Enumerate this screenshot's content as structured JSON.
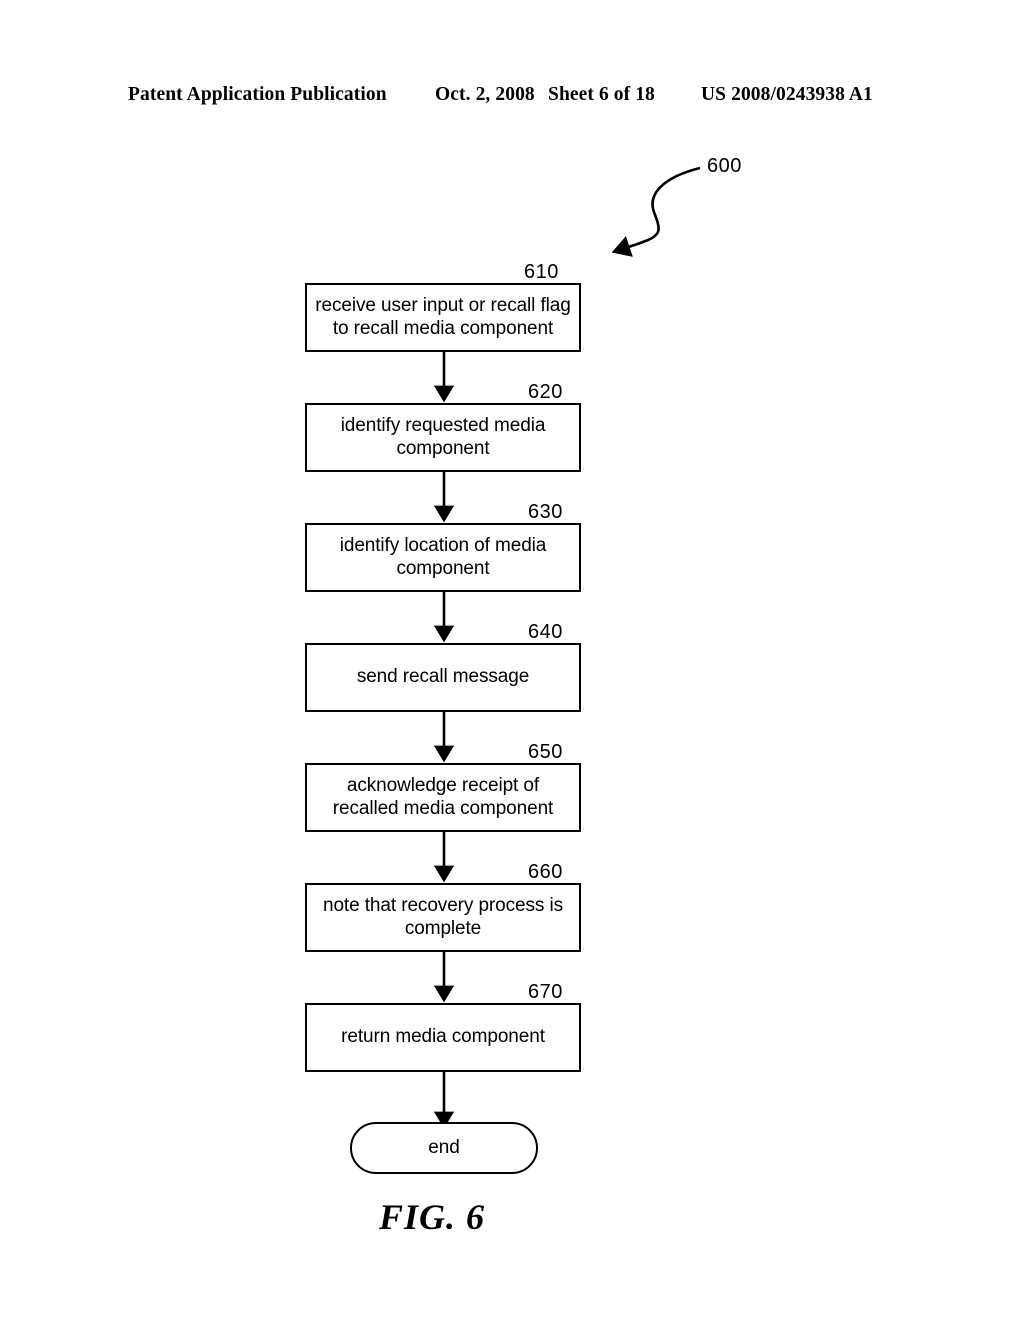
{
  "header": {
    "publication": "Patent Application Publication",
    "date": "Oct. 2, 2008",
    "sheet": "Sheet 6 of 18",
    "patent_number": "US 2008/0243938 A1"
  },
  "figure": {
    "caption": "FIG. 6",
    "diagram_label": "600",
    "nodes": [
      {
        "id": "610",
        "ref": "610",
        "text": "receive user input or recall flag\nto recall media component",
        "shape": "process"
      },
      {
        "id": "620",
        "ref": "620",
        "text": "identify requested media\ncomponent",
        "shape": "process"
      },
      {
        "id": "630",
        "ref": "630",
        "text": "identify location of media\ncomponent",
        "shape": "process"
      },
      {
        "id": "640",
        "ref": "640",
        "text": "send recall message",
        "shape": "process"
      },
      {
        "id": "650",
        "ref": "650",
        "text": "acknowledge receipt of\nrecalled media component",
        "shape": "process"
      },
      {
        "id": "660",
        "ref": "660",
        "text": "note that recovery process is\ncomplete",
        "shape": "process"
      },
      {
        "id": "670",
        "ref": "670",
        "text": "return media component",
        "shape": "process"
      },
      {
        "id": "end",
        "ref": "",
        "text": "end",
        "shape": "terminator"
      }
    ]
  },
  "colors": {
    "ink": "#000000",
    "page": "#ffffff"
  }
}
